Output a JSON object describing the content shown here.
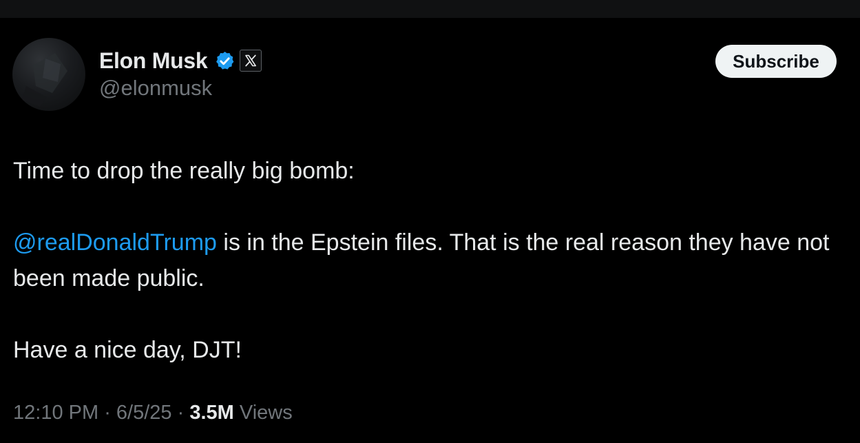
{
  "author": {
    "display_name": "Elon Musk",
    "handle": "@elonmusk",
    "verified_icon": "verified-badge-icon",
    "affiliate_icon": "x-logo-icon"
  },
  "actions": {
    "subscribe_label": "Subscribe"
  },
  "tweet": {
    "line1": "Time to drop the really big bomb:",
    "mention": "@realDonaldTrump",
    "line2_rest": " is in the Epstein files. That is the real reason they have not been made public.",
    "line3": "Have a nice day, DJT!"
  },
  "meta": {
    "time": "12:10 PM",
    "date": "6/5/25",
    "separator": " · ",
    "views_count": "3.5M",
    "views_label": " Views"
  },
  "colors": {
    "background": "#000000",
    "text": "#e7e9ea",
    "secondary": "#71767b",
    "accent": "#1d9bf0",
    "button_bg": "#eff3f4"
  }
}
